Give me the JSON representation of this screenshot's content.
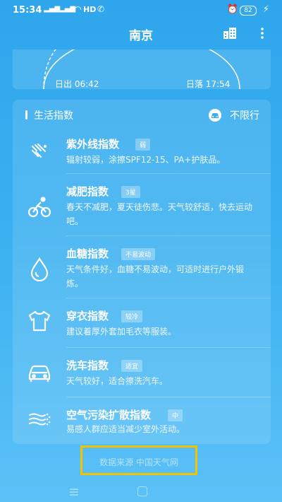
{
  "status_bar": {
    "time": "15:34",
    "network": "HD",
    "battery": "82"
  },
  "app_bar": {
    "title": "南京"
  },
  "sun": {
    "sunrise": "日出 06:42",
    "sunset": "日落 17:54"
  },
  "life_index": {
    "header": "生活指数",
    "traffic_limit": "不限行",
    "items": [
      {
        "name": "紫外线指数",
        "level": "弱",
        "desc": "辐射较弱，涂擦SPF12-15、PA+护肤品。",
        "icon": "uv-rays-icon"
      },
      {
        "name": "减肥指数",
        "level": "3星",
        "desc": "春天不减肥，夏天徒伤悲。天气较舒适，快去运动吧。",
        "icon": "cycling-icon"
      },
      {
        "name": "血糖指数",
        "level": "不易波动",
        "desc": "天气条件好，血糖不易波动，可适时进行户外锻炼。",
        "icon": "blood-drop-icon"
      },
      {
        "name": "穿衣指数",
        "level": "较冷",
        "desc": "建议着厚外套加毛衣等服装。",
        "icon": "tshirt-icon"
      },
      {
        "name": "洗车指数",
        "level": "适宜",
        "desc": "天气较好，适合擦洗汽车。",
        "icon": "car-wash-icon"
      },
      {
        "name": "空气污染扩散指数",
        "level": "中",
        "desc": "易感人群应适当减少室外活动。",
        "icon": "air-diffusion-icon"
      }
    ]
  },
  "footer": {
    "source": "数据来源 中国天气网"
  }
}
